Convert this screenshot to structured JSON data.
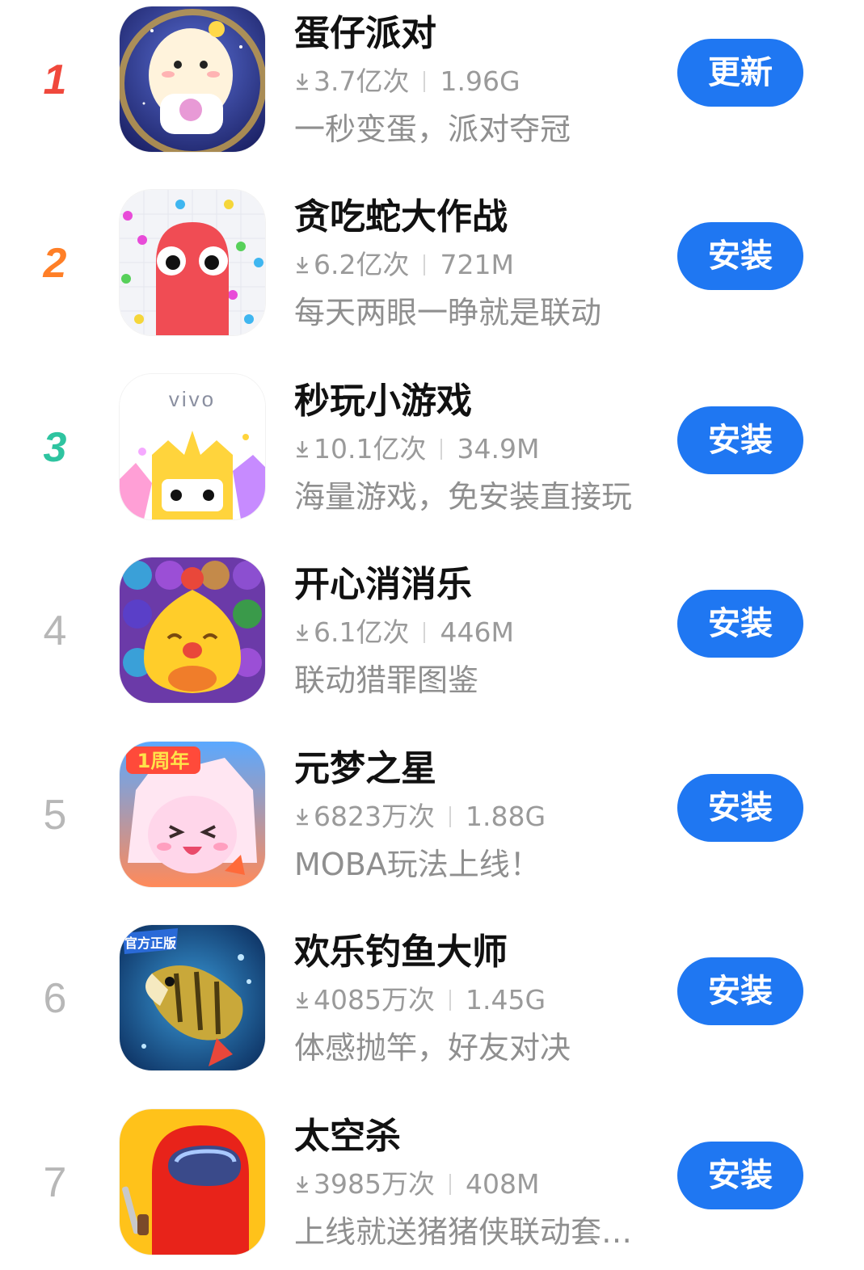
{
  "colors": {
    "button": "#1f77f2",
    "rank1": "#f0483c",
    "rank2": "#ff7f27",
    "rank3": "#2ec4a0",
    "rankOther": "#b7b7b7"
  },
  "apps": [
    {
      "rank": "1",
      "name": "蛋仔派对",
      "downloads": "3.7亿次",
      "size": "1.96G",
      "desc": "一秒变蛋，派对夺冠",
      "action": "更新",
      "icon": "eggy-party-icon"
    },
    {
      "rank": "2",
      "name": "贪吃蛇大作战",
      "downloads": "6.2亿次",
      "size": "721M",
      "desc": "每天两眼一睁就是联动",
      "action": "安装",
      "icon": "snake-icon"
    },
    {
      "rank": "3",
      "name": "秒玩小游戏",
      "downloads": "10.1亿次",
      "size": "34.9M",
      "desc": "海量游戏，免安装直接玩",
      "action": "安装",
      "icon": "vivo-minigame-icon",
      "icon_text": "vivo"
    },
    {
      "rank": "4",
      "name": "开心消消乐",
      "downloads": "6.1亿次",
      "size": "446M",
      "desc": "联动猎罪图鉴",
      "action": "安装",
      "icon": "happy-match-icon"
    },
    {
      "rank": "5",
      "name": "元梦之星",
      "downloads": "6823万次",
      "size": "1.88G",
      "desc": "MOBA玩法上线！",
      "action": "安装",
      "icon": "dream-star-icon",
      "icon_text": "1周年"
    },
    {
      "rank": "6",
      "name": "欢乐钓鱼大师",
      "downloads": "4085万次",
      "size": "1.45G",
      "desc": "体感抛竿，好友对决",
      "action": "安装",
      "icon": "fishing-icon",
      "icon_text": "官方正版"
    },
    {
      "rank": "7",
      "name": "太空杀",
      "downloads": "3985万次",
      "size": "408M",
      "desc": "上线就送猪猪侠联动套…",
      "action": "安装",
      "icon": "space-kill-icon"
    }
  ]
}
